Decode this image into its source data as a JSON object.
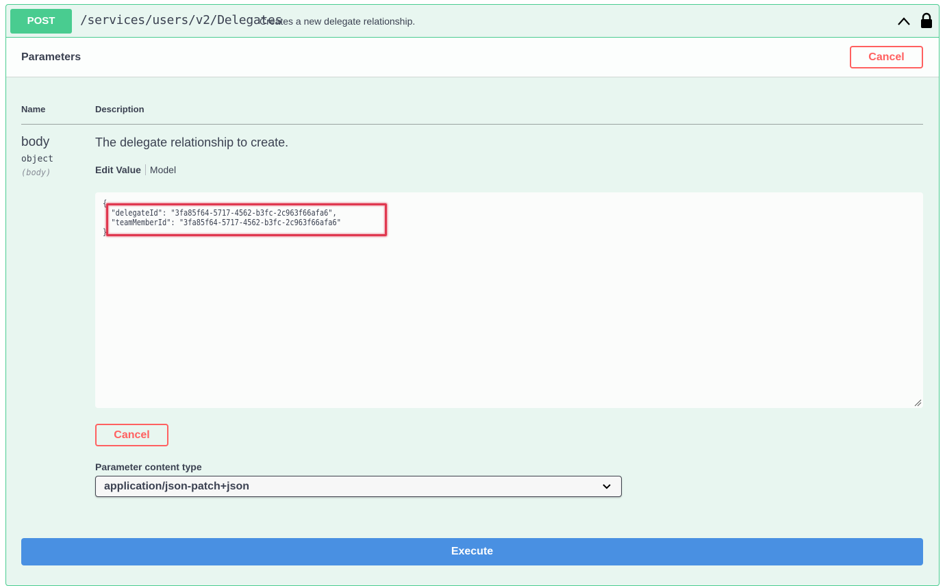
{
  "operation": {
    "method": "POST",
    "path": "/services/users/v2/Delegates",
    "summary": "Creates a new delegate relationship."
  },
  "parameters": {
    "title": "Parameters",
    "cancel_label": "Cancel",
    "columns": {
      "name": "Name",
      "description": "Description"
    },
    "body_param": {
      "name": "body",
      "type": "object",
      "in": "(body)",
      "description": "The delegate relationship to create.",
      "tabs": [
        "Edit Value",
        "Model"
      ],
      "value": "{\n  \"delegateId\": \"3fa85f64-5717-4562-b3fc-2c963f66afa6\",\n  \"teamMemberId\": \"3fa85f64-5717-4562-b3fc-2c963f66afa6\"\n}"
    },
    "content_type": {
      "label": "Parameter content type",
      "selected": "application/json-patch+json"
    },
    "execute_label": "Execute"
  },
  "colors": {
    "post_accent": "#49cc90",
    "cancel_red": "#ff6060",
    "execute_blue": "#4990e2",
    "highlight": "#e0384f"
  },
  "icons": [
    "chevron-up-icon",
    "lock-icon",
    "chevron-down-icon",
    "resize-handle-icon"
  ]
}
